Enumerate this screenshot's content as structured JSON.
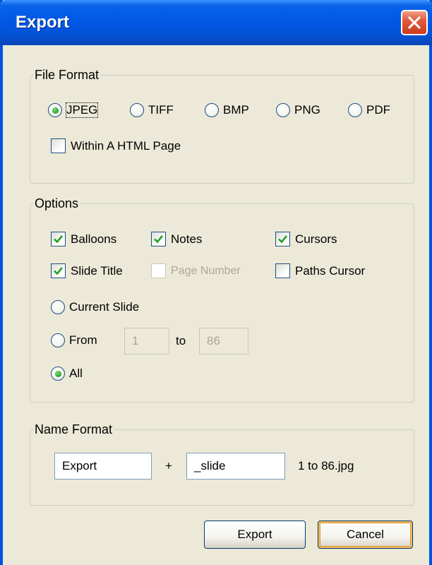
{
  "window": {
    "title": "Export"
  },
  "file_format": {
    "legend": "File Format",
    "options": [
      "JPEG",
      "TIFF",
      "BMP",
      "PNG",
      "PDF"
    ],
    "selected": "JPEG",
    "html_page_label": "Within A HTML Page",
    "html_page_checked": false
  },
  "options": {
    "legend": "Options",
    "balloons": {
      "label": "Balloons",
      "checked": true
    },
    "notes": {
      "label": "Notes",
      "checked": true
    },
    "cursors": {
      "label": "Cursors",
      "checked": true
    },
    "slide_title": {
      "label": "Slide Title",
      "checked": true
    },
    "page_number": {
      "label": "Page Number",
      "checked": false,
      "disabled": true
    },
    "paths_cursor": {
      "label": "Paths Cursor",
      "checked": false
    },
    "range": {
      "current_label": "Current Slide",
      "from_label": "From",
      "to_label": "to",
      "from_value": "1",
      "to_value": "86",
      "all_label": "All",
      "selected": "All"
    }
  },
  "name_format": {
    "legend": "Name Format",
    "prefix": "Export",
    "plus": "+",
    "suffix": "_slide",
    "result": "1 to 86.jpg"
  },
  "buttons": {
    "export": "Export",
    "cancel": "Cancel"
  },
  "colors": {
    "title_bar": "#0058e6",
    "dialog_bg": "#ece9d8",
    "radio_dot": "#21a121",
    "check_mark": "#21a121",
    "close_button": "#e2593c"
  }
}
